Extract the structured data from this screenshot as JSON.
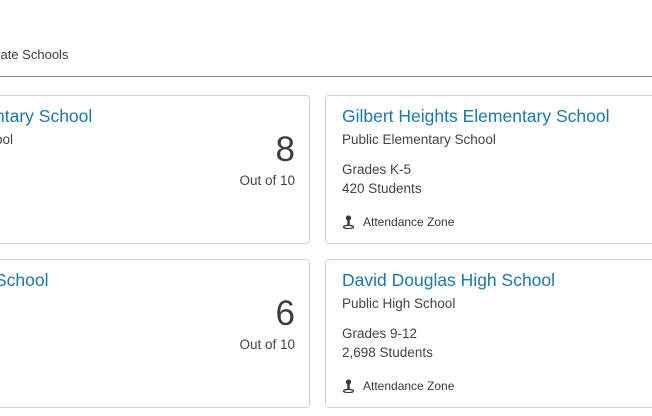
{
  "tabs": {
    "partial_label": "vate Schools"
  },
  "cards": {
    "left_top": {
      "title": "ntary School",
      "subtitle": "ool",
      "rating": "8",
      "rating_out_of": "Out of 10"
    },
    "right_top": {
      "title": "Gilbert Heights Elementary School",
      "type": "Public Elementary School",
      "grades": "Grades K-5",
      "students": "420 Students",
      "zone": "Attendance Zone"
    },
    "left_bottom": {
      "title": "School",
      "rating": "6",
      "rating_out_of": "Out of 10"
    },
    "right_bottom": {
      "title": "David Douglas High School",
      "type": "Public High School",
      "grades": "Grades 9-12",
      "students": "2,698 Students",
      "zone": "Attendance Zone"
    }
  },
  "colors": {
    "title": "#1a7aa6",
    "border": "#d3d3d3",
    "divider": "#8a8a8a"
  },
  "icons": {
    "zone": "map-pin-person-icon"
  }
}
